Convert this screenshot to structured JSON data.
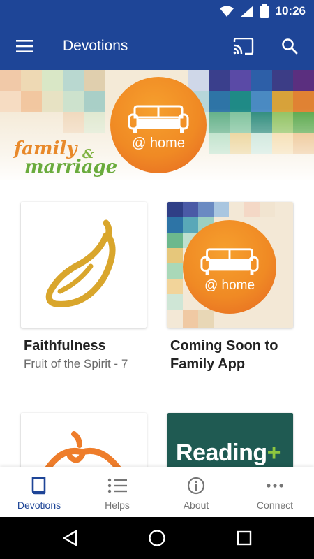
{
  "status_bar": {
    "time": "10:26"
  },
  "app_bar": {
    "title": "Devotions"
  },
  "banner": {
    "circle_text": "@ home",
    "brand_word1": "family",
    "brand_amp": "&",
    "brand_word2": "marriage"
  },
  "cards": [
    {
      "title": "Faithfulness",
      "subtitle": "Fruit of the Spirit - 7"
    },
    {
      "title": "Coming Soon to Family App",
      "subtitle": "",
      "circle_text": "@ home"
    },
    {
      "title": "",
      "subtitle": ""
    },
    {
      "title": "",
      "subtitle": "",
      "thumb_text": "Reading",
      "thumb_plus": "+"
    }
  ],
  "bottom_nav": {
    "items": [
      {
        "label": "Devotions",
        "icon": "book-icon",
        "active": true
      },
      {
        "label": "Helps",
        "icon": "list-icon",
        "active": false
      },
      {
        "label": "About",
        "icon": "info-icon",
        "active": false
      },
      {
        "label": "Connect",
        "icon": "more-horizontal-icon",
        "active": false
      }
    ]
  },
  "colors": {
    "primary": "#1e4597",
    "accent_orange": "#f08a24",
    "accent_green": "#6aab3c",
    "banana_gold": "#d9a62c",
    "pumpkin_orange": "#ee7d2b",
    "reading_teal": "#1f5a52"
  }
}
